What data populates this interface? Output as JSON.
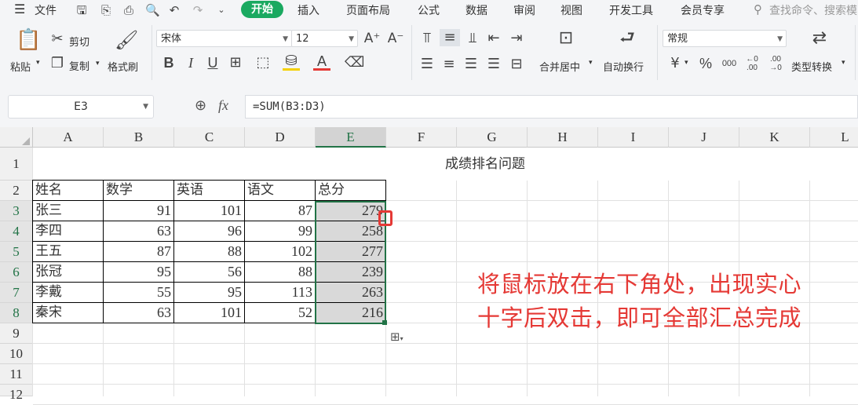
{
  "topbar": {
    "file_menu": "文件",
    "tabs": [
      "开始",
      "插入",
      "页面布局",
      "公式",
      "数据",
      "审阅",
      "视图",
      "开发工具",
      "会员专享"
    ],
    "search_placeholder": "查找命令、搜索模"
  },
  "ribbon": {
    "paste": "粘贴",
    "cut": "剪切",
    "copy": "复制",
    "format_painter": "格式刷",
    "font_name": "宋体",
    "font_size": "12",
    "merge_center": "合并居中",
    "wrap_text": "自动换行",
    "number_format": "常规",
    "type_convert": "类型转换",
    "bold": "B",
    "italic": "I",
    "underline": "U",
    "font_color_glyph": "A",
    "percent": "%",
    "currency": "¥",
    "thousands": "000"
  },
  "formula": {
    "cell_ref": "E3",
    "formula_text": "=SUM(B3:D3)",
    "fx": "fx"
  },
  "sheet": {
    "columns": [
      "A",
      "B",
      "C",
      "D",
      "E",
      "F",
      "G",
      "H",
      "I",
      "J",
      "K",
      "L"
    ],
    "rows": [
      "1",
      "2",
      "3",
      "4",
      "5",
      "6",
      "7",
      "8",
      "9",
      "10",
      "11",
      "12"
    ],
    "title": "成绩排名问题",
    "headers": [
      "姓名",
      "数学",
      "英语",
      "语文",
      "总分"
    ],
    "data": [
      [
        "张三",
        "91",
        "101",
        "87",
        "279"
      ],
      [
        "李四",
        "63",
        "96",
        "99",
        "258"
      ],
      [
        "王五",
        "87",
        "88",
        "102",
        "277"
      ],
      [
        "张冠",
        "95",
        "56",
        "88",
        "239"
      ],
      [
        "李戴",
        "55",
        "95",
        "113",
        "263"
      ],
      [
        "秦宋",
        "63",
        "101",
        "52",
        "216"
      ]
    ]
  },
  "annotation": {
    "line1": "将鼠标放在右下角处，出现实心",
    "line2": "十字后双击，即可全部汇总完成"
  },
  "colors": {
    "accent_green": "#1aa960",
    "selection_green": "#217346",
    "annotation_red": "#e53935"
  }
}
